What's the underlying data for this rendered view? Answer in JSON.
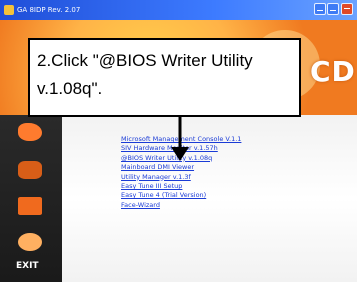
{
  "window": {
    "title": "GA 8IDP Rev. 2.07",
    "brand_text": "CD"
  },
  "sidebar": {
    "exit_label": "EXIT"
  },
  "callout": {
    "text": "2.Click \"@BIOS Writer Utility v.1.08q\"."
  },
  "links": [
    "Microsoft Management Console V.1.1",
    "SIV Hardware Monitor v.1.57h",
    "@BIOS Writer Utility v.1.08q",
    "Mainboard DMI Viewer",
    "Utility Manager v.1.3f",
    "Easy Tune III Setup",
    "Easy Tune 4 (Trial Version)",
    "Face-Wizard"
  ],
  "colors": {
    "titlebar": "#1f4ed8",
    "window_bg": "#f07a20",
    "link": "#1a3bd6",
    "sidebar": "#1a1a1a"
  }
}
